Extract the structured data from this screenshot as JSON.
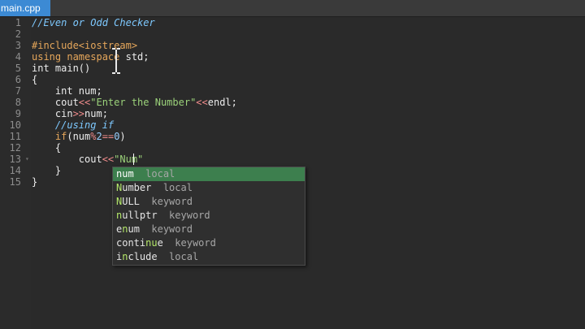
{
  "tab": {
    "label": "main.cpp"
  },
  "line_numbers": [
    "1",
    "2",
    "3",
    "4",
    "5",
    "6",
    "7",
    "8",
    "9",
    "10",
    "11",
    "12",
    "13",
    "14",
    "15"
  ],
  "code": {
    "l1": "//Even or Odd Checker",
    "l3_kw": "#include<iostream>",
    "l4_kw1": "using namespace",
    "l4_rest": " std;",
    "l5": "int main()",
    "l6": "{",
    "l7": "    int num;",
    "l8_a": "    cout",
    "l8_op1": "<<",
    "l8_str": "\"Enter the Number\"",
    "l8_op2": "<<",
    "l8_b": "endl;",
    "l9_a": "    cin",
    "l9_op": ">>",
    "l9_b": "num;",
    "l10": "    //using if",
    "l11_kw": "    if",
    "l11_a": "(num",
    "l11_op": "%",
    "l11_n1": "2",
    "l11_op2": "==",
    "l11_n2": "0",
    "l11_b": ")",
    "l12": "    {",
    "l13_a": "        cout",
    "l13_op": "<<",
    "l13_str": "\"Num\"",
    "l14": "    }",
    "l15": "}"
  },
  "autocomplete": {
    "items": [
      {
        "pre": "",
        "match": "num",
        "post": "",
        "kind": "local"
      },
      {
        "pre": "",
        "match": "N",
        "post": "umber",
        "kind": "local",
        "m2": ""
      },
      {
        "pre": "",
        "match": "N",
        "post": "ULL",
        "kind": "keyword"
      },
      {
        "pre": "",
        "match": "n",
        "post": "ullptr",
        "kind": "keyword"
      },
      {
        "pre": "e",
        "match": "n",
        "post": "um",
        "kind": "keyword"
      },
      {
        "pre": "conti",
        "match": "nu",
        "post": "e",
        "kind": "keyword"
      },
      {
        "pre": "i",
        "match": "n",
        "post": "clude",
        "kind": "local"
      }
    ]
  },
  "colors": {
    "tab_active": "#3c8ad4",
    "comment": "#7ec9ff",
    "keyword": "#e6a75b",
    "string": "#9bd27a",
    "selected_item": "#3d7f4e"
  }
}
